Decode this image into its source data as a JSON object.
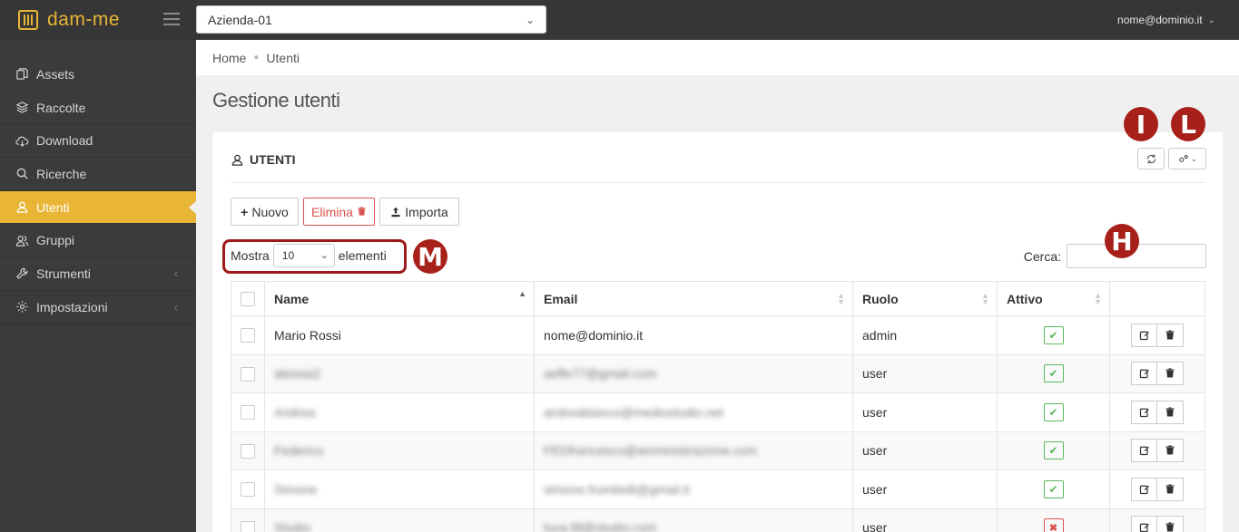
{
  "app": {
    "name": "dam-me"
  },
  "header": {
    "company": "Azienda-01",
    "user_email": "nome@dominio.it"
  },
  "sidebar": {
    "items": [
      {
        "label": "Assets",
        "icon": "files-icon"
      },
      {
        "label": "Raccolte",
        "icon": "layers-icon"
      },
      {
        "label": "Download",
        "icon": "cloud-download-icon"
      },
      {
        "label": "Ricerche",
        "icon": "search-icon"
      },
      {
        "label": "Utenti",
        "icon": "user-icon",
        "active": true
      },
      {
        "label": "Gruppi",
        "icon": "users-icon"
      },
      {
        "label": "Strumenti",
        "icon": "wrench-icon"
      },
      {
        "label": "Impostazioni",
        "icon": "gear-icon"
      }
    ]
  },
  "breadcrumb": {
    "home": "Home",
    "current": "Utenti"
  },
  "page": {
    "title": "Gestione utenti"
  },
  "card": {
    "title": "UTENTI",
    "buttons": {
      "new": "Nuovo",
      "delete": "Elimina",
      "import": "Importa"
    },
    "length": {
      "prefix": "Mostra",
      "value": "10",
      "suffix": "elementi"
    },
    "search_label": "Cerca:"
  },
  "markers": {
    "refresh": "I",
    "settings": "L",
    "search": "H",
    "length": "M"
  },
  "table": {
    "columns": [
      "Name",
      "Email",
      "Ruolo",
      "Attivo"
    ],
    "rows": [
      {
        "name": "Mario Rossi",
        "email": "nome@dominio.it",
        "role": "admin",
        "active": true,
        "blurred": false
      },
      {
        "name": "alessia2",
        "email": "aeffe77@gmail.com",
        "role": "user",
        "active": true,
        "blurred": true
      },
      {
        "name": "Andrea",
        "email": "andreabianco@mediostudio.net",
        "role": "user",
        "active": true,
        "blurred": true
      },
      {
        "name": "Federico",
        "email": "FEDfrancesco@amministrazione.com",
        "role": "user",
        "active": true,
        "blurred": true
      },
      {
        "name": "Simone",
        "email": "simone.frombelli@gmail.it",
        "role": "user",
        "active": true,
        "blurred": true
      },
      {
        "name": "Studio",
        "email": "luca.fill@studio.com",
        "role": "user",
        "active": false,
        "blurred": true
      }
    ]
  },
  "colors": {
    "accent": "#e8b535",
    "topbar": "#363636",
    "sidebar": "#3b3b3b",
    "marker": "#a8201a",
    "success": "#5cb85c",
    "danger": "#d9534f"
  }
}
